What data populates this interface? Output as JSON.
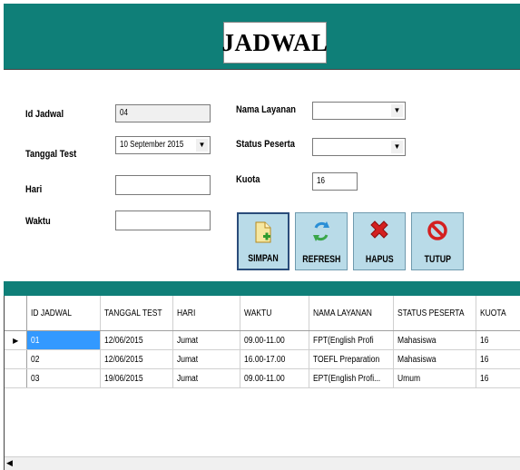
{
  "header": {
    "title": "JADWAL",
    "bg_color": "#0f7f78"
  },
  "form": {
    "id_label": "Id Jadwal",
    "id_value": "04",
    "tanggal_label": "Tanggal Test",
    "tanggal_value": "10 September 2015",
    "hari_label": "Hari",
    "hari_value": "",
    "waktu_label": "Waktu",
    "waktu_value": "",
    "layanan_label": "Nama Layanan",
    "layanan_value": "",
    "status_label": "Status Peserta",
    "status_value": "",
    "kuota_label": "Kuota",
    "kuota_value": "16"
  },
  "buttons": {
    "simpan": "SIMPAN",
    "refresh": "REFRESH",
    "hapus": "HAPUS",
    "tutup": "TUTUP"
  },
  "grid": {
    "headers": [
      "ID JADWAL",
      "TANGGAL TEST",
      "HARI",
      "WAKTU",
      "NAMA LAYANAN",
      "STATUS PESERTA",
      "KUOTA"
    ],
    "rows": [
      [
        "01",
        "12/06/2015",
        "Jumat",
        "09.00-11.00",
        "FPT(English Profi",
        "Mahasiswa",
        "16"
      ],
      [
        "02",
        "12/06/2015",
        "Jumat",
        "16.00-17.00",
        "TOEFL Preparation",
        "Mahasiswa",
        "16"
      ],
      [
        "03",
        "19/06/2015",
        "Jumat",
        "09.00-11.00",
        "EPT(English Profi...",
        "Umum",
        "16"
      ]
    ],
    "row_indicator": "▶"
  }
}
